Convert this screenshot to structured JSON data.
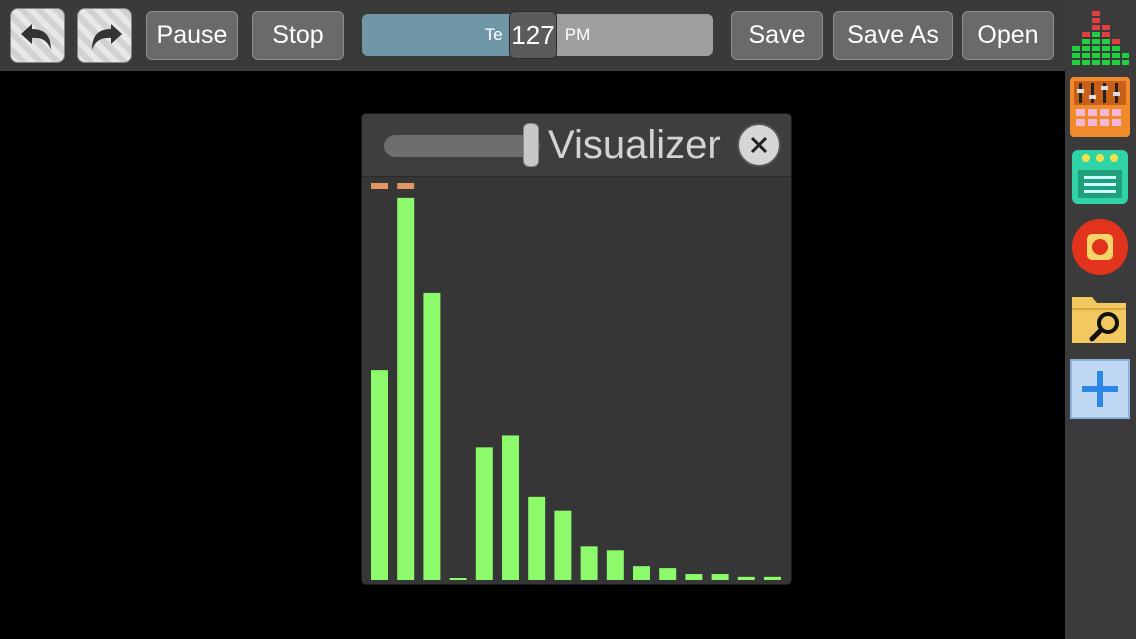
{
  "toolbar": {
    "undo_icon": "undo-arrow-icon",
    "redo_icon": "redo-arrow-icon",
    "pause_label": "Pause",
    "stop_label": "Stop",
    "tempo": {
      "label": "Te",
      "unit": "PM",
      "value": "127"
    },
    "save_label": "Save",
    "save_as_label": "Save As",
    "open_label": "Open"
  },
  "sidebar": {
    "items": [
      {
        "icon": "visualizer-equalizer-icon"
      },
      {
        "icon": "mixer-drum-pad-icon"
      },
      {
        "icon": "sequencer-notes-icon"
      },
      {
        "icon": "record-icon"
      },
      {
        "icon": "folder-search-icon"
      },
      {
        "icon": "add-instrument-icon"
      }
    ]
  },
  "visualizer": {
    "title": "Visualizer",
    "volume_level": 1.0,
    "bar_color": "#8cfa6a",
    "peak_color": "#e3965f",
    "bars": [
      0.53,
      0.965,
      0.725,
      0.005,
      0.335,
      0.365,
      0.21,
      0.175,
      0.085,
      0.075,
      0.035,
      0.03,
      0.015,
      0.015,
      0.008,
      0.008
    ],
    "peaks": [
      1.0,
      1.0,
      null,
      null,
      null,
      null,
      null,
      null,
      null,
      null,
      null,
      null,
      null,
      null,
      null,
      null
    ]
  }
}
